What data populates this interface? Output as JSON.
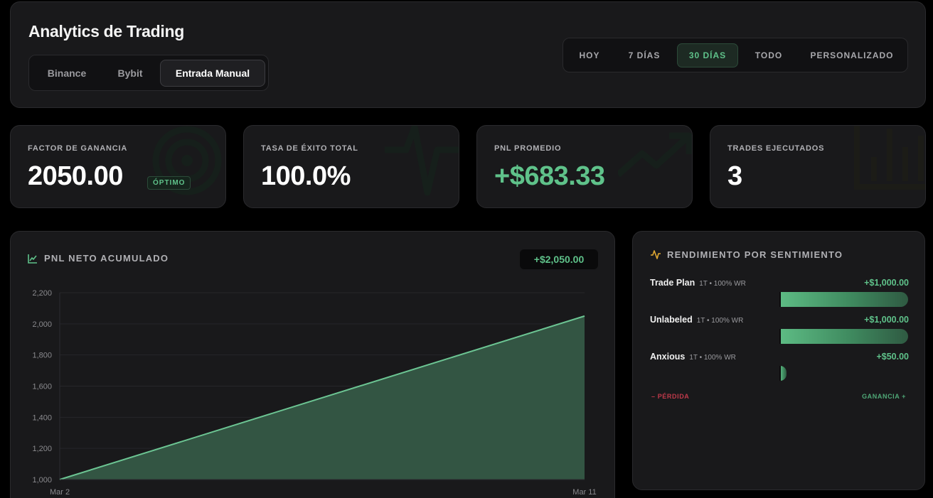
{
  "header": {
    "title": "Analytics de Trading",
    "sources": [
      "Binance",
      "Bybit",
      "Entrada Manual"
    ],
    "active_source": "Entrada Manual",
    "ranges": [
      "HOY",
      "7 DÍAS",
      "30 DÍAS",
      "TODO",
      "PERSONALIZADO"
    ],
    "active_range": "30 DÍAS"
  },
  "kpis": {
    "profit_factor": {
      "label": "FACTOR DE GANANCIA",
      "value": "2050.00",
      "badge": "ÓPTIMO",
      "icon": "target-icon"
    },
    "win_rate": {
      "label": "TASA DE ÉXITO TOTAL",
      "value": "100.0%",
      "icon": "pulse-icon"
    },
    "avg_pnl": {
      "label": "PNL PROMEDIO",
      "value": "+$683.33",
      "icon": "trending-up-icon"
    },
    "trades": {
      "label": "TRADES EJECUTADOS",
      "value": "3",
      "icon": "bar-chart-icon"
    }
  },
  "cumulative": {
    "title": "PNL NETO ACUMULADO",
    "total": "+$2,050.00",
    "icon": "line-chart-icon"
  },
  "chart_data": {
    "type": "area",
    "x": [
      "Mar 2",
      "Mar 11"
    ],
    "values": [
      1000,
      2050
    ],
    "ylim": [
      1000,
      2200
    ],
    "yticks": [
      1000,
      1200,
      1400,
      1600,
      1800,
      2000,
      2200
    ],
    "ytick_labels": [
      "1,000",
      "1,200",
      "1,400",
      "1,600",
      "1,800",
      "2,000",
      "2,200"
    ],
    "grid": true,
    "colors": {
      "line": "#6cc593",
      "fill": "#335543"
    }
  },
  "sentiment": {
    "title": "RENDIMIENTO POR SENTIMIENTO",
    "icon": "activity-icon",
    "rows": [
      {
        "name": "Trade Plan",
        "meta": "1T • 100% WR",
        "value": "+$1,000.00",
        "amount": 1000
      },
      {
        "name": "Unlabeled",
        "meta": "1T • 100% WR",
        "value": "+$1,000.00",
        "amount": 1000
      },
      {
        "name": "Anxious",
        "meta": "1T • 100% WR",
        "value": "+$50.00",
        "amount": 50
      }
    ],
    "loss_label": "– PÉRDIDA",
    "gain_label": "GANANCIA +"
  },
  "colors": {
    "accent": "#5fc28a",
    "loss": "#c0394a",
    "panel": "#19191b",
    "background": "#000000"
  }
}
